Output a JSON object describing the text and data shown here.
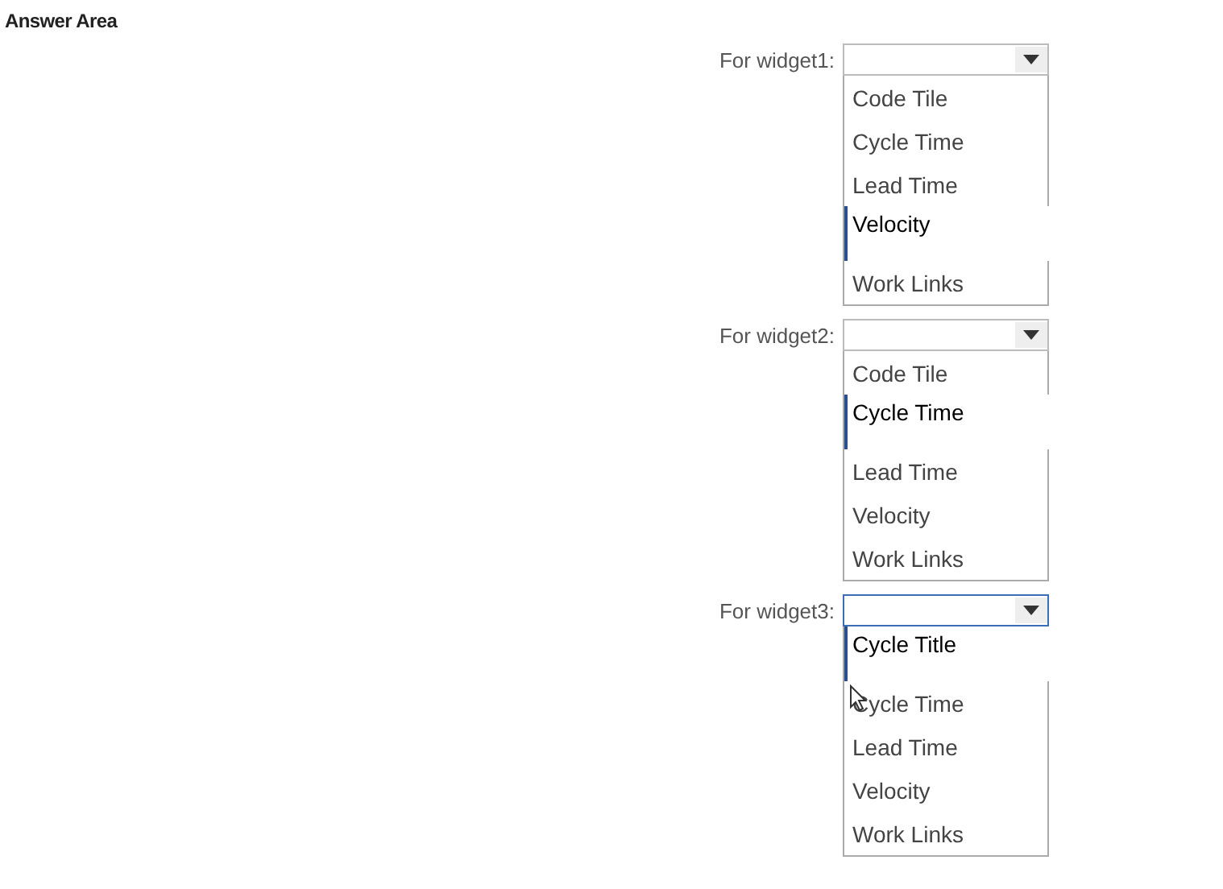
{
  "title": "Answer Area",
  "widgets": [
    {
      "label": "For widget1:",
      "focused": false,
      "options": [
        {
          "text": "Code Tile",
          "selected": false,
          "hovered": false
        },
        {
          "text": "Cycle Time",
          "selected": false,
          "hovered": false
        },
        {
          "text": "Lead Time",
          "selected": false,
          "hovered": false
        },
        {
          "text": "Velocity",
          "selected": true,
          "hovered": false
        },
        {
          "text": "Work Links",
          "selected": false,
          "hovered": false
        }
      ]
    },
    {
      "label": "For widget2:",
      "focused": false,
      "options": [
        {
          "text": "Code Tile",
          "selected": false,
          "hovered": false
        },
        {
          "text": "Cycle Time",
          "selected": true,
          "hovered": false
        },
        {
          "text": "Lead Time",
          "selected": false,
          "hovered": false
        },
        {
          "text": "Velocity",
          "selected": false,
          "hovered": false
        },
        {
          "text": "Work Links",
          "selected": false,
          "hovered": false
        }
      ]
    },
    {
      "label": "For widget3:",
      "focused": true,
      "options": [
        {
          "text": "Cycle Title",
          "selected": true,
          "hovered": false
        },
        {
          "text": "Cycle Time",
          "selected": false,
          "hovered": true
        },
        {
          "text": "Lead Time",
          "selected": false,
          "hovered": false
        },
        {
          "text": "Velocity",
          "selected": false,
          "hovered": false
        },
        {
          "text": "Work Links",
          "selected": false,
          "hovered": false
        }
      ]
    }
  ]
}
